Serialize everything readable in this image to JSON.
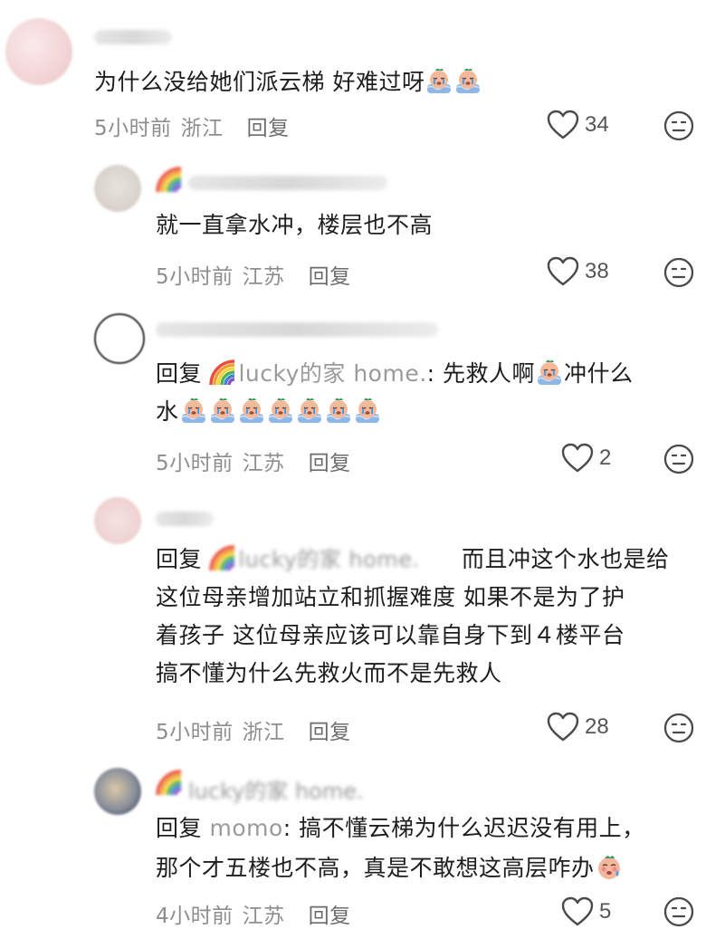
{
  "comments": [
    {
      "text": "为什么没给她们派云梯 好难过呀",
      "emoji_count": 2,
      "time": "5小时前",
      "location": "浙江",
      "reply": "回复",
      "likes": "34"
    },
    {
      "text": "就一直拿水冲，楼层也不高",
      "time": "5小时前",
      "location": "江苏",
      "reply": "回复",
      "likes": "38"
    },
    {
      "prefix": "回复",
      "target": "lucky的家 home.",
      "line1": "先救人啊",
      "line1b": "冲什么",
      "line2": "水",
      "time": "5小时前",
      "location": "江苏",
      "reply": "回复",
      "likes": "2"
    },
    {
      "prefix": "回复",
      "target_blur": "lucky的家 home.",
      "line1": "而且冲这个水也是给",
      "line2": "这位母亲增加站立和抓握难度 如果不是为了护",
      "line3": "着孩子 这位母亲应该可以靠自身下到４楼平台",
      "line4": "搞不懂为什么先救火而不是先救人",
      "time": "5小时前",
      "location": "浙江",
      "reply": "回复",
      "likes": "28"
    },
    {
      "blur_name": "lucky的家 home.",
      "prefix": "回复",
      "target": "momo",
      "line1": "搞不懂云梯为什么迟迟没有用上，",
      "line2": "那个才五楼也不高，真是不敢想这高层咋办",
      "time": "4小时前",
      "location": "江苏",
      "reply": "回复",
      "likes": "5"
    }
  ],
  "colors": {
    "text": "#1e1e1e",
    "meta": "#8e8e8e",
    "icon": "#4a4a4a"
  },
  "icons": [
    "heart-outline-icon",
    "dislike-face-icon",
    "crying-emoji",
    "rainbow-emoji"
  ]
}
